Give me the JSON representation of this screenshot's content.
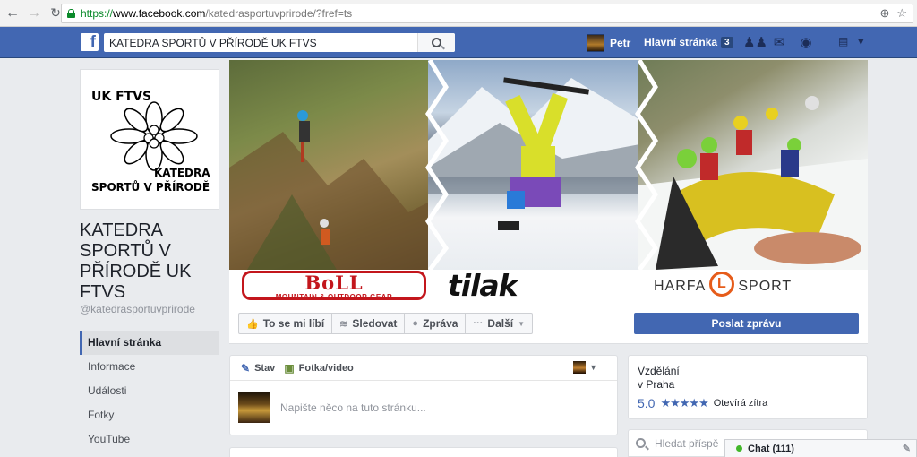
{
  "browser": {
    "url_secure": "https://",
    "url_domain": "www.facebook.com",
    "url_path": "/katedrasportuvprirode/?fref=ts"
  },
  "topbar": {
    "logo": "f",
    "search_value": "KATEDRA SPORTŮ V PŘÍRODĚ UK FTVS",
    "user_name": "Petr",
    "home_label": "Hlavní stránka",
    "home_count": "3"
  },
  "profile": {
    "logo_top": "UK FTVS",
    "logo_line1": "KATEDRA",
    "logo_line2": "SPORTŮ V PŘÍRODĚ",
    "title": "KATEDRA SPORTŮ V PŘÍRODĚ UK FTVS",
    "handle": "@katedrasportuvprirode"
  },
  "sidebar": {
    "items": [
      {
        "label": "Hlavní stránka",
        "active": true
      },
      {
        "label": "Informace"
      },
      {
        "label": "Události"
      },
      {
        "label": "Fotky"
      },
      {
        "label": "YouTube"
      }
    ]
  },
  "brands": {
    "boll": "BoLL",
    "boll_tag": "MOUNTAIN & OUTDOOR GEAR",
    "tilak": "tilak",
    "harfa_left": "HARFA",
    "harfa_l": "L",
    "harfa_right": "SPORT"
  },
  "actions": {
    "like": "To se mi líbí",
    "follow": "Sledovat",
    "message": "Zpráva",
    "more": "Další",
    "send": "Poslat zprávu"
  },
  "composer": {
    "tab_status": "Stav",
    "tab_photo": "Fotka/video",
    "placeholder": "Napište něco na tuto stránku..."
  },
  "info": {
    "category": "Vzdělání",
    "city": "v Praha",
    "rating": "5.0",
    "stars": "★★★★★",
    "open": "Otevírá zítra"
  },
  "page_search": {
    "placeholder": "Hledat příspě"
  },
  "chat": {
    "label": "Chat (111)"
  },
  "colors": {
    "fb_blue": "#4267b2",
    "boll_red": "#c3161c",
    "harfa_orange": "#e65c1a"
  }
}
